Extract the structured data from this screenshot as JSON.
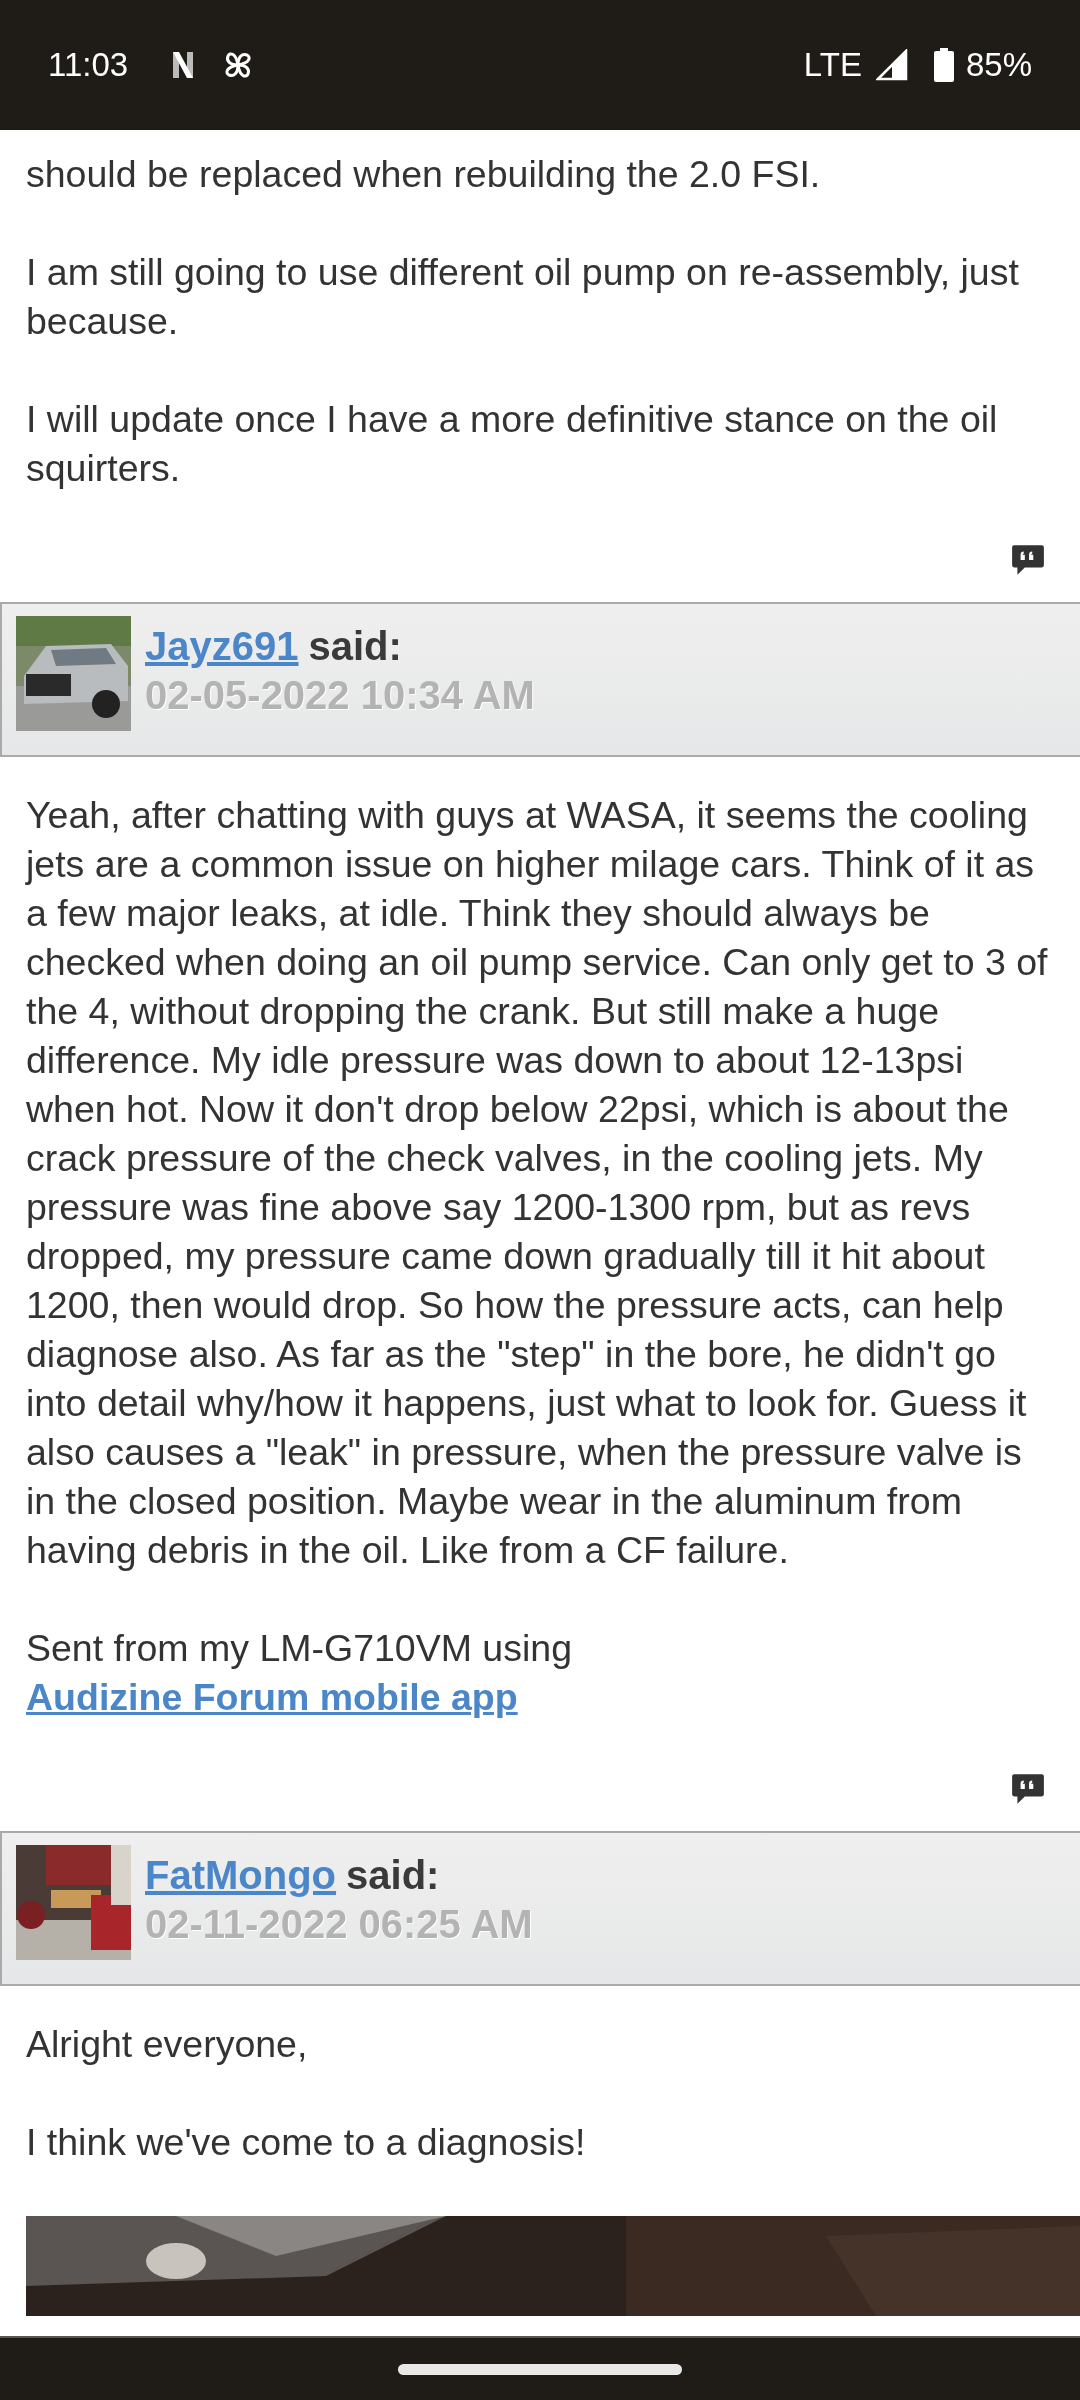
{
  "status_bar": {
    "time": "11:03",
    "network": "LTE",
    "battery": "85%"
  },
  "posts": [
    {
      "paragraphs": [
        "should be replaced when rebuilding the 2.0 FSI.",
        "I am still going to use different oil pump on re-assembly, just because.",
        "I will update once I have a more definitive stance on the oil squirters."
      ],
      "quote_button": true
    },
    {
      "author": "Jayz691",
      "said": "said:",
      "date": "02-05-2022 10:34 AM",
      "avatar": {
        "kind": "picture"
      },
      "paragraphs": [
        "Yeah, after chatting with guys at WASA, it seems the cooling jets are a common issue on higher milage cars. Think of it as a few major leaks, at idle. Think they should always be checked when doing an oil pump service. Can only get to 3 of the 4, without dropping the crank. But still make a huge difference. My idle pressure was down to about 12-13psi when hot. Now it don't drop below 22psi, which is about the crack pressure of the check valves, in the cooling jets. My pressure was fine above say 1200-1300 rpm, but as revs dropped, my pressure came down gradually till it hit about 1200, then would drop. So how the pressure acts, can help diagnose also. As far as the \"step\" in the bore, he didn't go into detail why/how it happens, just what to look for. Guess it also causes a \"leak\" in pressure, when the pressure valve is in the closed position. Maybe wear in the aluminum from having debris in the oil. Like from a CF failure."
      ],
      "signature": {
        "text": "Sent from my LM-G710VM using",
        "link": "Audizine Forum mobile app"
      },
      "quote_button": true
    },
    {
      "author": "FatMongo",
      "said": "said:",
      "date": "02-11-2022 06:25 AM",
      "avatar": {
        "kind": "picture"
      },
      "paragraphs": [
        "Alright everyone,",
        "I think we've come to a diagnosis!"
      ],
      "attachment": {
        "kind": "picture"
      }
    }
  ]
}
